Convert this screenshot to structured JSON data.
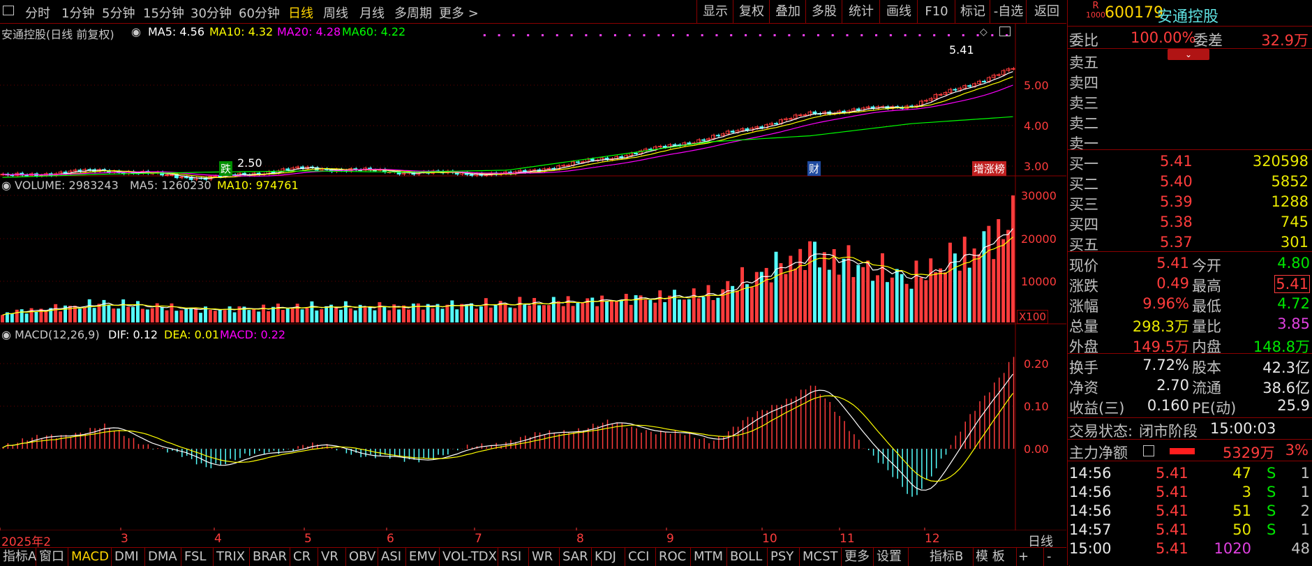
{
  "toolbar": {
    "periods": [
      "分时",
      "1分钟",
      "5分钟",
      "15分钟",
      "30分钟",
      "60分钟",
      "日线",
      "周线",
      "月线",
      "多周期",
      "更多 >"
    ],
    "selected_period": "日线",
    "right_buttons": [
      "显示",
      "复权",
      "叠加",
      "多股",
      "统计",
      "画线",
      "F10",
      "标记",
      "-自选",
      "返回"
    ]
  },
  "stock": {
    "code": "600179",
    "name": "安通控股",
    "badge_top": "R",
    "badge_bottom": "1000"
  },
  "price_panel": {
    "title": "安通控股(日线 前复权)",
    "ma5": "MA5: 4.56",
    "ma10": "MA10: 4.32",
    "ma20": "MA20: 4.28",
    "ma60": "MA60: 4.22",
    "axis": [
      "5.00",
      "4.00",
      "3.00"
    ],
    "high_marker": "5.41",
    "low_marker": "2.50",
    "tag_die": "跌",
    "tag_cai": "财",
    "tag_zengzhang": "增涨榜"
  },
  "volume_panel": {
    "title": "VOLUME: 2983243",
    "ma5": "MA5: 1260230",
    "ma10": "MA10: 974761",
    "axis": [
      "30000",
      "20000",
      "10000"
    ],
    "unit": "X100"
  },
  "macd_panel": {
    "title": "MACD(12,26,9)",
    "dif": "DIF: 0.12",
    "dea": "DEA: 0.01",
    "macd": "MACD: 0.22",
    "axis": [
      "0.20",
      "0.10",
      "0.00"
    ]
  },
  "x_axis": [
    "2025年2",
    "3",
    "4",
    "5",
    "6",
    "7",
    "8",
    "9",
    "10",
    "11",
    "12"
  ],
  "period_label": "日线",
  "colors": {
    "up": "#ff3c3c",
    "down": "#54ffff",
    "ma5": "#ffffff",
    "ma10": "#ffff00",
    "ma20": "#ff00ff",
    "ma60": "#00ff00",
    "border": "#8b0000"
  },
  "order_book": {
    "weibi_label": "委比",
    "weibi_value": "100.00%",
    "weicha_label": "委差",
    "weicha_value": "32.9万",
    "sell": [
      {
        "label": "卖五"
      },
      {
        "label": "卖四"
      },
      {
        "label": "卖三"
      },
      {
        "label": "卖二"
      },
      {
        "label": "卖一"
      }
    ],
    "buy": [
      {
        "label": "买一",
        "price": "5.41",
        "vol": "320598"
      },
      {
        "label": "买二",
        "price": "5.40",
        "vol": "5852"
      },
      {
        "label": "买三",
        "price": "5.39",
        "vol": "1288"
      },
      {
        "label": "买四",
        "price": "5.38",
        "vol": "745"
      },
      {
        "label": "买五",
        "price": "5.37",
        "vol": "301"
      }
    ]
  },
  "quote": [
    {
      "l": "现价",
      "v": "5.41",
      "l2": "今开",
      "v2": "4.80"
    },
    {
      "l": "涨跌",
      "v": "0.49",
      "l2": "最高",
      "v2": "5.41"
    },
    {
      "l": "涨幅",
      "v": "9.96%",
      "l2": "最低",
      "v2": "4.72"
    },
    {
      "l": "总量",
      "v": "298.3万",
      "l2": "量比",
      "v2": "3.85"
    },
    {
      "l": "外盘",
      "v": "149.5万",
      "l2": "内盘",
      "v2": "148.8万"
    }
  ],
  "fundamentals": [
    {
      "l": "换手",
      "v": "7.72%",
      "l2": "股本",
      "v2": "42.3亿"
    },
    {
      "l": "净资",
      "v": "2.70",
      "l2": "流通",
      "v2": "38.6亿"
    },
    {
      "l": "收益(三)",
      "v": "0.160",
      "l2": "PE(动)",
      "v2": "25.9"
    }
  ],
  "status": {
    "label": "交易状态:",
    "value": "闭市阶段",
    "time": "15:00:03"
  },
  "main_flow": {
    "label": "主力净额",
    "value": "5329万",
    "pct": "3%"
  },
  "ticks": [
    {
      "t": "14:56",
      "p": "5.41",
      "v": "47",
      "s": "S",
      "n": "1"
    },
    {
      "t": "14:56",
      "p": "5.41",
      "v": "3",
      "s": "S",
      "n": "1"
    },
    {
      "t": "14:56",
      "p": "5.41",
      "v": "51",
      "s": "S",
      "n": "2"
    },
    {
      "t": "14:57",
      "p": "5.41",
      "v": "50",
      "s": "S",
      "n": "1"
    },
    {
      "t": "15:00",
      "p": "5.41",
      "v": "1020",
      "s": "",
      "n": "48"
    }
  ],
  "bottom_tabs": [
    "指标A",
    "窗口",
    "MACD",
    "DMI",
    "DMA",
    "FSL",
    "TRIX",
    "BRAR",
    "CR",
    "VR",
    "OBV",
    "ASI",
    "EMV",
    "VOL-TDX",
    "RSI",
    "WR",
    "SAR",
    "KDJ",
    "CCI",
    "ROC",
    "MTM",
    "BOLL",
    "PSY",
    "MCST",
    "更多",
    "设置"
  ],
  "bottom_selected": "MACD",
  "bottom_right": [
    "指标B",
    "模 板",
    "+",
    "-"
  ],
  "chart_data": [
    {
      "type": "line",
      "title": "安通控股(日线 前复权)",
      "x": [
        "2025年2",
        "3",
        "4",
        "5",
        "6",
        "7",
        "8",
        "9",
        "10",
        "11",
        "12"
      ],
      "series": [
        {
          "name": "MA60",
          "values": [
            2.72,
            2.8,
            2.85,
            2.88,
            2.85,
            2.9,
            3.25,
            3.6,
            3.75,
            4.05,
            4.22
          ]
        },
        {
          "name": "close",
          "values": [
            2.75,
            2.9,
            2.7,
            2.95,
            2.85,
            2.8,
            3.2,
            3.7,
            4.3,
            4.5,
            5.41
          ]
        }
      ],
      "ylim": [
        2.3,
        5.6
      ]
    },
    {
      "type": "bar",
      "title": "VOLUME",
      "x": [
        "2025年2",
        "3",
        "4",
        "5",
        "6",
        "7",
        "8",
        "9",
        "10",
        "11",
        "12"
      ],
      "values": [
        3000,
        6000,
        4000,
        5000,
        5000,
        6000,
        7000,
        9000,
        22000,
        14000,
        29832
      ],
      "ylim": [
        0,
        33000
      ]
    },
    {
      "type": "bar",
      "title": "MACD(12,26,9)",
      "x": [
        "2025年2",
        "3",
        "4",
        "5",
        "6",
        "7",
        "8",
        "9",
        "10",
        "11",
        "12"
      ],
      "values": [
        0.01,
        0.05,
        -0.04,
        0.01,
        -0.03,
        0.02,
        0.06,
        0.02,
        0.15,
        -0.12,
        0.22
      ],
      "ylim": [
        -0.2,
        0.25
      ]
    }
  ]
}
